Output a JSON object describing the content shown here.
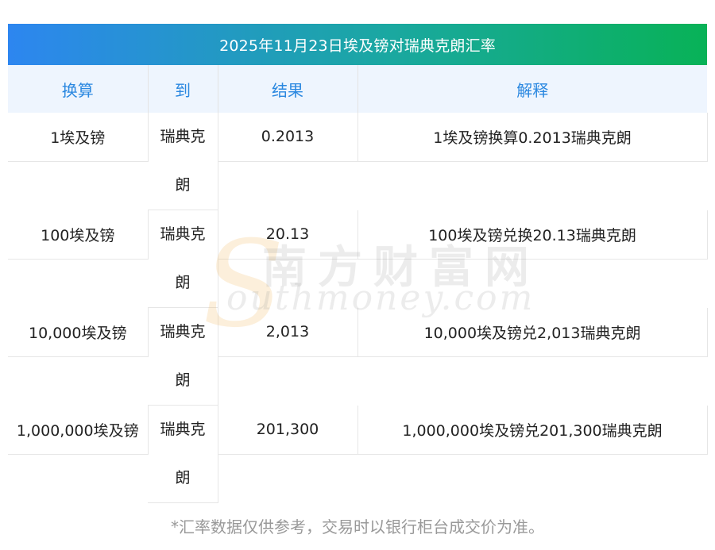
{
  "table": {
    "title": "2025年11月23日埃及镑对瑞典克朗汇率",
    "headers": {
      "convert": "换算",
      "to": "到",
      "result": "结果",
      "explain": "解释"
    },
    "rows": [
      {
        "amount": "1埃及镑",
        "to": "瑞典克朗",
        "result": "0.2013",
        "explain": "1埃及镑换算0.2013瑞典克朗"
      },
      {
        "amount": "100埃及镑",
        "to": "瑞典克朗",
        "result": "20.13",
        "explain": "100埃及镑兑换20.13瑞典克朗"
      },
      {
        "amount": "10,000埃及镑",
        "to": "瑞典克朗",
        "result": "2,013",
        "explain": "10,000埃及镑兑2,013瑞典克朗"
      },
      {
        "amount": "1,000,000埃及镑",
        "to": "瑞典克朗",
        "result": "201,300",
        "explain": "1,000,000埃及镑兑201,300瑞典克朗"
      }
    ]
  },
  "watermark": {
    "cn": "南方财富网",
    "en": "outhmoney.com",
    "s": "S"
  },
  "footnote": "*汇率数据仅供参考，交易时以银行柜台成交价为准。"
}
